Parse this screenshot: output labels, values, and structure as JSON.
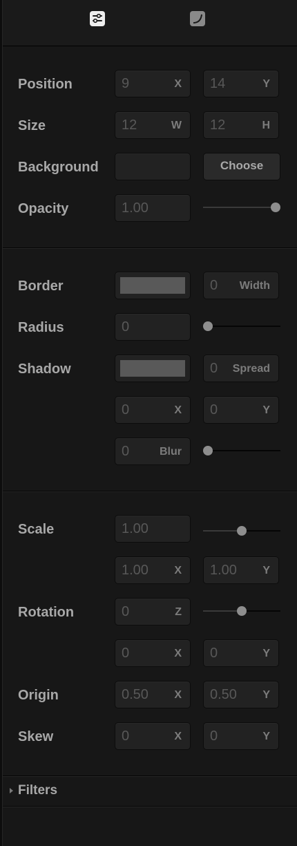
{
  "toolbar": {
    "settings_icon": "sliders-icon",
    "curve_icon": "curve-icon"
  },
  "layout": {
    "position_label": "Position",
    "position_x": "9",
    "position_y": "14",
    "size_label": "Size",
    "size_w": "12",
    "size_h": "12",
    "background_label": "Background",
    "choose_label": "Choose",
    "opacity_label": "Opacity",
    "opacity_value": "1.00",
    "opacity_slider": 1.0
  },
  "border_section": {
    "border_label": "Border",
    "border_width": "0",
    "radius_label": "Radius",
    "radius_value": "0",
    "radius_slider": 0.0,
    "shadow_label": "Shadow",
    "shadow_spread": "0",
    "shadow_x": "0",
    "shadow_y": "0",
    "shadow_blur": "0",
    "blur_slider": 0.0
  },
  "transform": {
    "scale_label": "Scale",
    "scale_value": "1.00",
    "scale_slider": 0.5,
    "scale_x": "1.00",
    "scale_y": "1.00",
    "rotation_label": "Rotation",
    "rotation_z": "0",
    "rotation_slider": 0.5,
    "rotation_x": "0",
    "rotation_y": "0",
    "origin_label": "Origin",
    "origin_x": "0.50",
    "origin_y": "0.50",
    "skew_label": "Skew",
    "skew_x": "0",
    "skew_y": "0"
  },
  "suffixes": {
    "x": "X",
    "y": "Y",
    "w": "W",
    "h": "H",
    "z": "Z",
    "width": "Width",
    "spread": "Spread",
    "blur": "Blur"
  },
  "filters": {
    "label": "Filters"
  },
  "colors": {
    "background_swatch": "#595959",
    "border_swatch": "#595959",
    "shadow_swatch": "#595959"
  }
}
